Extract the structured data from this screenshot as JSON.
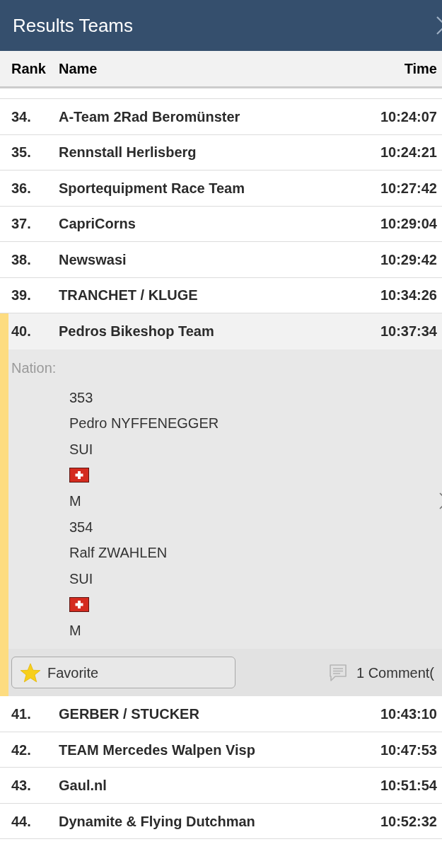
{
  "title_bar": {
    "title": "Results Teams"
  },
  "columns": [
    {
      "label": "Rank"
    },
    {
      "label": "Name"
    },
    {
      "label": "Time"
    }
  ],
  "rows": [
    {
      "rank": "34.",
      "name": "A-Team 2Rad Beromünster",
      "time": "10:24:07",
      "expanded": false
    },
    {
      "rank": "35.",
      "name": "Rennstall Herlisberg",
      "time": "10:24:21",
      "expanded": false
    },
    {
      "rank": "36.",
      "name": "Sportequipment Race Team",
      "time": "10:27:42",
      "expanded": false
    },
    {
      "rank": "37.",
      "name": "CapriCorns",
      "time": "10:29:04",
      "expanded": false
    },
    {
      "rank": "38.",
      "name": "Newswasi",
      "time": "10:29:42",
      "expanded": false
    },
    {
      "rank": "39.",
      "name": "TRANCHET / KLUGE",
      "time": "10:34:26",
      "expanded": false
    },
    {
      "rank": "40.",
      "name": "Pedros Bikeshop Team",
      "time": "10:37:34",
      "expanded": true,
      "details": {
        "nation_label": "Nation:",
        "members": [
          {
            "bib": "353",
            "name": "Pedro NYFFENEGGER",
            "nation": "SUI",
            "gender": "M"
          },
          {
            "bib": "354",
            "name": "Ralf ZWAHLEN",
            "nation": "SUI",
            "gender": "M"
          }
        ],
        "favorite": {
          "label": "Favorite"
        },
        "comments": {
          "label": "1 Comment("
        }
      }
    },
    {
      "rank": "41.",
      "name": "GERBER / STUCKER",
      "time": "10:43:10",
      "expanded": false
    },
    {
      "rank": "42.",
      "name": "TEAM Mercedes Walpen Visp",
      "time": "10:47:53",
      "expanded": false
    },
    {
      "rank": "43.",
      "name": "Gaul.nl",
      "time": "10:51:54",
      "expanded": false
    },
    {
      "rank": "44.",
      "name": "Dynamite & Flying Dutchman",
      "time": "10:52:32",
      "expanded": false
    }
  ]
}
